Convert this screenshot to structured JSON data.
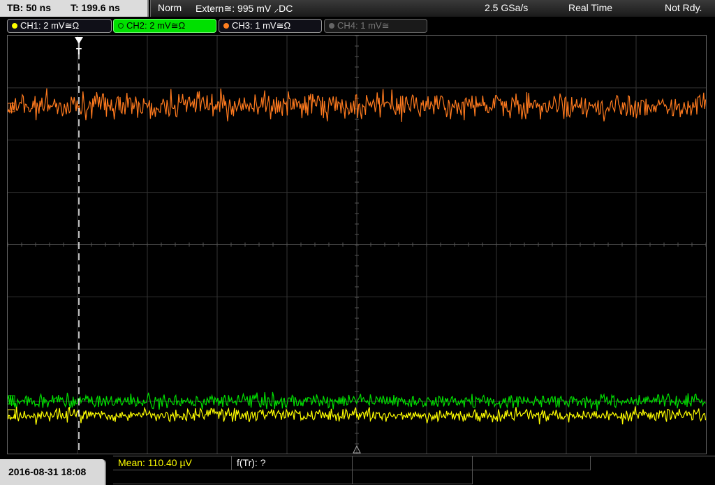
{
  "header": {
    "timebase": "TB: 50 ns",
    "trigger_time": "T: 199.6 ns",
    "acq_mode": "Norm",
    "trigger": "Extern≅: 995 mV ⸝DC",
    "sample_rate": "2.5 GSa/s",
    "mode": "Real Time",
    "status": "Not Rdy."
  },
  "channels": [
    {
      "label": "CH1: 2 mV≅Ω",
      "color": "#ffff00",
      "active": false,
      "enabled": true
    },
    {
      "label": "CH2: 2 mV≅Ω",
      "color": "#00e000",
      "active": true,
      "enabled": true
    },
    {
      "label": "CH3: 1 mV≅Ω",
      "color": "#ff7f20",
      "active": false,
      "enabled": true
    },
    {
      "label": "CH4: 1 mV≅",
      "color": "#666666",
      "active": false,
      "enabled": false
    }
  ],
  "traces": {
    "ch3_color": "#ff7a1e",
    "ch2_color": "#00e000",
    "ch1_color": "#ffff00",
    "trigger_marker": "T"
  },
  "footer": {
    "datetime": "2016-08-31 18:08",
    "measurements": [
      {
        "label": "Mean: 110.40 µV",
        "color": "#ffff00"
      },
      {
        "label": "f(Tr): ?",
        "color": "#ffffff"
      },
      {
        "label": "",
        "color": "#ffffff"
      },
      {
        "label": "",
        "color": "#ffffff"
      },
      {
        "label": "",
        "color": "#ffffff"
      },
      {
        "label": "",
        "color": "#ffffff"
      }
    ]
  }
}
